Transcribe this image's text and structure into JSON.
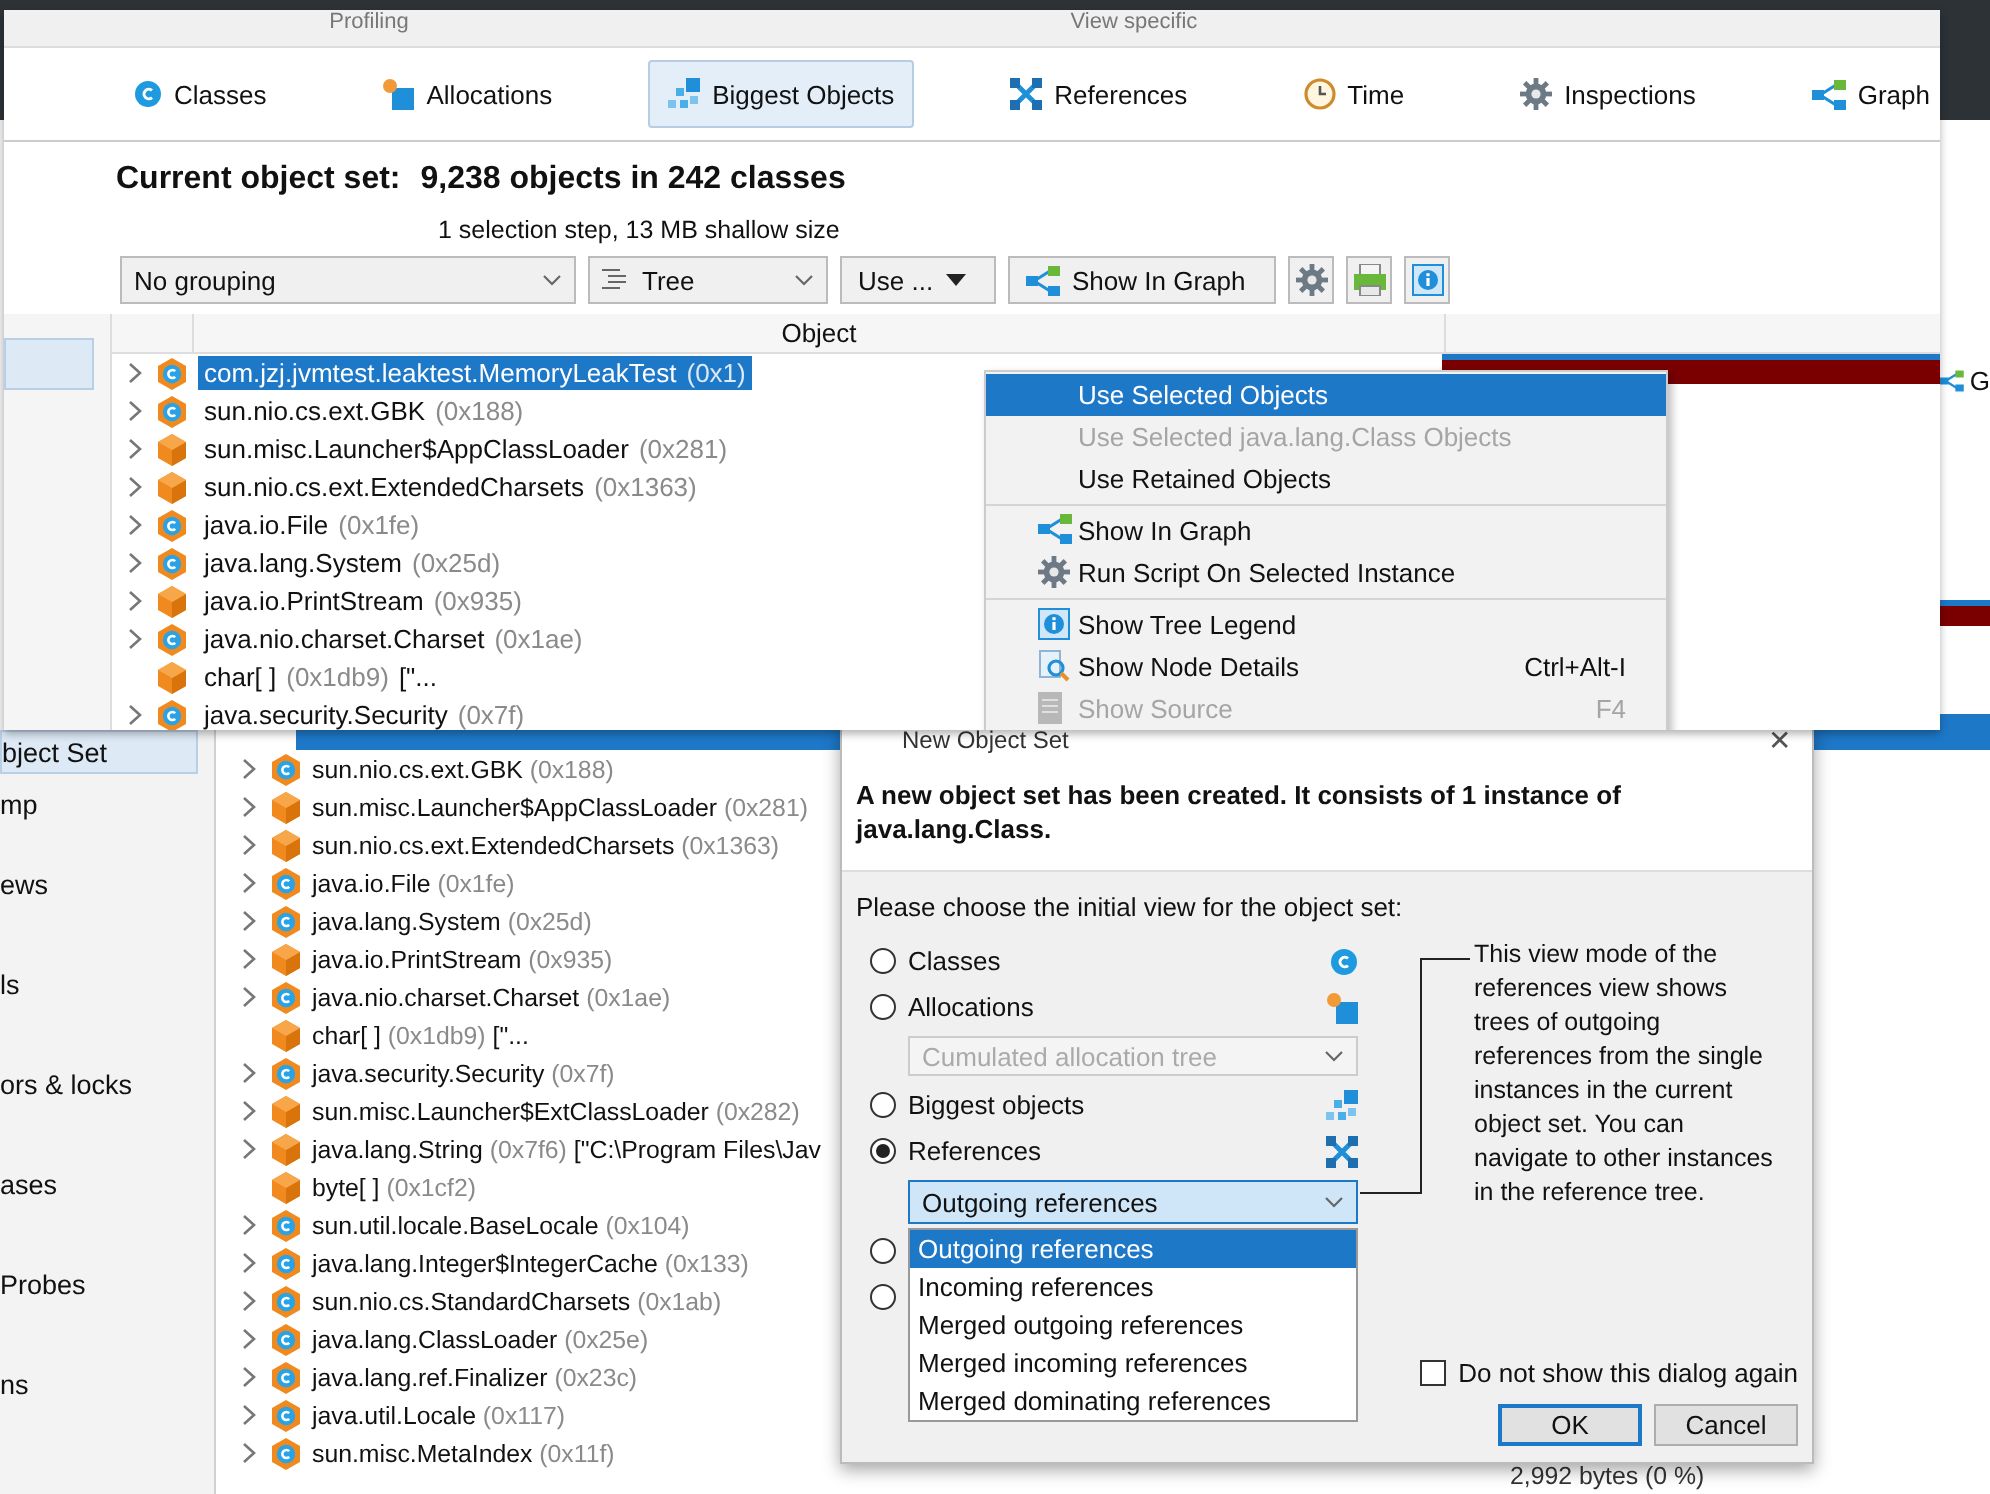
{
  "background": {
    "sidebar": [
      {
        "label": "bject Set",
        "selected": true
      },
      {
        "label": "mp",
        "selected": false
      },
      {
        "label": "ews",
        "selected": false
      },
      {
        "label": "ls",
        "selected": false
      },
      {
        "label": "ors & locks",
        "selected": false
      },
      {
        "label": "ases",
        "selected": false
      },
      {
        "label": "Probes",
        "selected": false
      },
      {
        "label": "ns",
        "selected": false
      }
    ],
    "tree_rows": [
      {
        "name": "sun.nio.cs.ext.GBK",
        "address": "(0x188)",
        "kind": "class",
        "expandable": true
      },
      {
        "name": "sun.misc.Launcher$AppClassLoader",
        "address": "(0x281)",
        "kind": "instance",
        "expandable": true
      },
      {
        "name": "sun.nio.cs.ext.ExtendedCharsets",
        "address": "(0x1363)",
        "kind": "instance",
        "expandable": true
      },
      {
        "name": "java.io.File",
        "address": "(0x1fe)",
        "kind": "class",
        "expandable": true
      },
      {
        "name": "java.lang.System",
        "address": "(0x25d)",
        "kind": "class",
        "expandable": true
      },
      {
        "name": "java.io.PrintStream",
        "address": "(0x935)",
        "kind": "instance",
        "expandable": true
      },
      {
        "name": "java.nio.charset.Charset",
        "address": "(0x1ae)",
        "kind": "class",
        "expandable": true
      },
      {
        "name": "char[ ]",
        "address": "(0x1db9)",
        "value": "[\"...",
        "kind": "instance",
        "expandable": false
      },
      {
        "name": "java.security.Security",
        "address": "(0x7f)",
        "kind": "class",
        "expandable": true
      },
      {
        "name": "sun.misc.Launcher$ExtClassLoader",
        "address": "(0x282)",
        "kind": "instance",
        "expandable": true
      },
      {
        "name": "java.lang.String",
        "address": "(0x7f6)",
        "value": "[\"C:\\Program Files\\Jav",
        "kind": "instance",
        "expandable": true
      },
      {
        "name": "byte[ ]",
        "address": "(0x1cf2)",
        "kind": "instance",
        "expandable": false
      },
      {
        "name": "sun.util.locale.BaseLocale",
        "address": "(0x104)",
        "kind": "class",
        "expandable": true
      },
      {
        "name": "java.lang.Integer$IntegerCache",
        "address": "(0x133)",
        "kind": "class",
        "expandable": true
      },
      {
        "name": "sun.nio.cs.StandardCharsets",
        "address": "(0x1ab)",
        "kind": "class",
        "expandable": true
      },
      {
        "name": "java.lang.ClassLoader",
        "address": "(0x25e)",
        "kind": "class",
        "expandable": true
      },
      {
        "name": "java.lang.ref.Finalizer",
        "address": "(0x23c)",
        "kind": "class",
        "expandable": true
      },
      {
        "name": "java.util.Locale",
        "address": "(0x117)",
        "kind": "class",
        "expandable": true
      },
      {
        "name": "sun.misc.MetaIndex",
        "address": "(0x11f)",
        "kind": "class",
        "expandable": true
      }
    ],
    "size_cell": "2,992 bytes (0 %)",
    "edge_tab": "G"
  },
  "profiler": {
    "groups": [
      "Profiling",
      "View specific"
    ],
    "tabs": [
      {
        "label": "Classes",
        "kind": "class",
        "selected": false
      },
      {
        "label": "Allocations",
        "kind": "alloc",
        "selected": false
      },
      {
        "label": "Biggest Objects",
        "kind": "biggest",
        "selected": true
      },
      {
        "label": "References",
        "kind": "refs",
        "selected": false
      },
      {
        "label": "Time",
        "kind": "time",
        "selected": false
      },
      {
        "label": "Inspections",
        "kind": "gear",
        "selected": false
      },
      {
        "label": "Graph",
        "kind": "graph",
        "selected": false
      }
    ],
    "object_set": {
      "label": "Current object set:",
      "value": "9,238 objects in 242 classes",
      "detail": "1 selection step, 13 MB shallow size"
    },
    "toolbar": {
      "grouping": "No grouping",
      "view": "Tree",
      "use_button": "Use ...",
      "graph_button": "Show In Graph"
    },
    "column": "Object",
    "rows": [
      {
        "name": "com.jzj.jvmtest.leaktest.MemoryLeakTest",
        "address": "(0x1)",
        "kind": "class",
        "expandable": true,
        "selected": true
      },
      {
        "name": "sun.nio.cs.ext.GBK",
        "address": "(0x188)",
        "kind": "class",
        "expandable": true,
        "selected": false
      },
      {
        "name": "sun.misc.Launcher$AppClassLoader",
        "address": "(0x281)",
        "kind": "instance",
        "expandable": true,
        "selected": false
      },
      {
        "name": "sun.nio.cs.ext.ExtendedCharsets",
        "address": "(0x1363)",
        "kind": "instance",
        "expandable": true,
        "selected": false
      },
      {
        "name": "java.io.File",
        "address": "(0x1fe)",
        "kind": "class",
        "expandable": true,
        "selected": false
      },
      {
        "name": "java.lang.System",
        "address": "(0x25d)",
        "kind": "class",
        "expandable": true,
        "selected": false
      },
      {
        "name": "java.io.PrintStream",
        "address": "(0x935)",
        "kind": "instance",
        "expandable": true,
        "selected": false
      },
      {
        "name": "java.nio.charset.Charset",
        "address": "(0x1ae)",
        "kind": "class",
        "expandable": true,
        "selected": false
      },
      {
        "name": "char[ ]",
        "address": "(0x1db9)",
        "value": "[\"...",
        "kind": "instance",
        "expandable": false,
        "selected": false
      },
      {
        "name": "java.security.Security",
        "address": "(0x7f)",
        "kind": "class",
        "expandable": true,
        "selected": false
      }
    ]
  },
  "context_menu": {
    "items": [
      {
        "kind": "plain",
        "label": "Use Selected Objects",
        "selected": true,
        "disabled": false
      },
      {
        "kind": "plain",
        "label": "Use Selected java.lang.Class Objects",
        "selected": false,
        "disabled": true
      },
      {
        "kind": "plain",
        "label": "Use Retained Objects",
        "selected": false,
        "disabled": false
      },
      {
        "kind": "separator"
      },
      {
        "kind": "graph",
        "label": "Show In Graph",
        "selected": false,
        "disabled": false
      },
      {
        "kind": "gear",
        "label": "Run Script On Selected Instance",
        "selected": false,
        "disabled": false
      },
      {
        "kind": "separator"
      },
      {
        "kind": "info",
        "label": "Show Tree Legend",
        "selected": false,
        "disabled": false
      },
      {
        "kind": "search",
        "label": "Show Node Details",
        "shortcut": "Ctrl+Alt-I",
        "selected": false,
        "disabled": false
      },
      {
        "kind": "file",
        "label": "Show Source",
        "shortcut": "F4",
        "selected": false,
        "disabled": true
      }
    ]
  },
  "dialog": {
    "title": "New Object Set",
    "close": "✕",
    "message": "A new object set has been created. It consists of 1 instance of java.lang.Class.",
    "prompt": "Please choose the initial view for the object set:",
    "options": [
      {
        "label": "Classes",
        "kind": "class",
        "selected": false
      },
      {
        "label": "Allocations",
        "kind": "alloc",
        "selected": false,
        "sub_select": {
          "value": "Cumulated allocation tree",
          "disabled": true
        }
      },
      {
        "label": "Biggest objects",
        "kind": "biggest",
        "selected": false
      },
      {
        "label": "References",
        "kind": "refs",
        "selected": true
      }
    ],
    "combo": {
      "value": "Outgoing references",
      "options": [
        {
          "label": "Outgoing references",
          "selected": true
        },
        {
          "label": "Incoming references",
          "selected": false
        },
        {
          "label": "Merged outgoing references",
          "selected": false
        },
        {
          "label": "Merged incoming references",
          "selected": false
        },
        {
          "label": "Merged dominating references",
          "selected": false
        }
      ]
    },
    "hidden_options": [
      {
        "selected": false
      },
      {
        "selected": false
      }
    ],
    "description": "This view mode of the references view shows trees of outgoing references from the single instances in the current object set. You can navigate to other instances in the reference tree.",
    "dont_show_again": {
      "label": "Do not show this dialog again",
      "checked": false
    },
    "buttons": [
      {
        "label": "OK",
        "default": true
      },
      {
        "label": "Cancel",
        "default": false
      }
    ]
  }
}
